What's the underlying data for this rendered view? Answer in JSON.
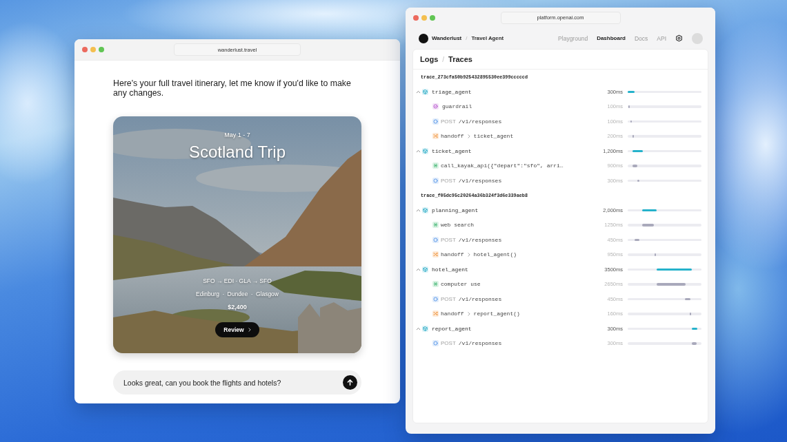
{
  "left_window": {
    "url": "wanderlust.travel",
    "message": "Here's your full travel itinerary, let me know if you'd like to make any changes.",
    "trip_card": {
      "dates": "May 1 - 7",
      "title": "Scotland Trip",
      "route": "SFO → EDI · GLA → SFO",
      "cities": "Edinburg · Dundee · Glasgow",
      "price": "$2,400",
      "button": "Review"
    },
    "composer": {
      "value": "Looks great, can you book the flights and hotels?"
    }
  },
  "right_window": {
    "url": "platform.openai.com",
    "org": "Wanderlust",
    "separator": "/",
    "project": "Travel Agent",
    "nav": [
      {
        "label": "Playground",
        "selected": false
      },
      {
        "label": "Dashboard",
        "selected": true
      },
      {
        "label": "Docs",
        "selected": false
      },
      {
        "label": "API",
        "selected": false
      }
    ],
    "breadcrumb": {
      "section": "Logs",
      "separator": "/",
      "page": "Traces"
    },
    "traces": [
      {
        "id": "trace_273cfa50b925432895530ee399cccccd",
        "agents": [
          {
            "name": "triage_agent",
            "duration": "300ms",
            "expanded": true,
            "children": [
              {
                "kind": "guardrail",
                "label": "guardrail",
                "duration": "100ms"
              },
              {
                "kind": "request",
                "method": "POST",
                "path": "/v1/responses",
                "duration": "100ms"
              },
              {
                "kind": "handoff",
                "label": "handoff",
                "target": "ticket_agent",
                "duration": "200ms"
              }
            ]
          },
          {
            "name": "ticket_agent",
            "duration": "1,200ms",
            "expanded": true,
            "children": [
              {
                "kind": "tool",
                "label": "call_kayak_api({\"depart\":\"sfo\", arri…",
                "duration": "900ms"
              },
              {
                "kind": "request",
                "method": "POST",
                "path": "/v1/responses",
                "duration": "300ms"
              }
            ]
          }
        ]
      },
      {
        "id": "trace_f05dc95c20264a36b324f3d6e339aeb8",
        "agents": [
          {
            "name": "planning_agent",
            "duration": "2,000ms",
            "expanded": true,
            "children": [
              {
                "kind": "tool",
                "label": "web search",
                "duration": "1250ms"
              },
              {
                "kind": "request",
                "method": "POST",
                "path": "/v1/responses",
                "duration": "450ms"
              },
              {
                "kind": "handoff",
                "label": "handoff",
                "target": "hotel_agent()",
                "duration": "950ms"
              }
            ]
          },
          {
            "name": "hotel_agent",
            "duration": "3500ms",
            "expanded": true,
            "children": [
              {
                "kind": "tool",
                "label": "computer use",
                "duration": "2650ms"
              },
              {
                "kind": "request",
                "method": "POST",
                "path": "/v1/responses",
                "duration": "450ms"
              },
              {
                "kind": "handoff",
                "label": "handoff",
                "target": "report_agent()",
                "duration": "160ms"
              }
            ]
          },
          {
            "name": "report_agent",
            "duration": "300ms",
            "expanded": true,
            "children": [
              {
                "kind": "request",
                "method": "POST",
                "path": "/v1/responses",
                "duration": "300ms"
              }
            ]
          }
        ]
      }
    ]
  }
}
